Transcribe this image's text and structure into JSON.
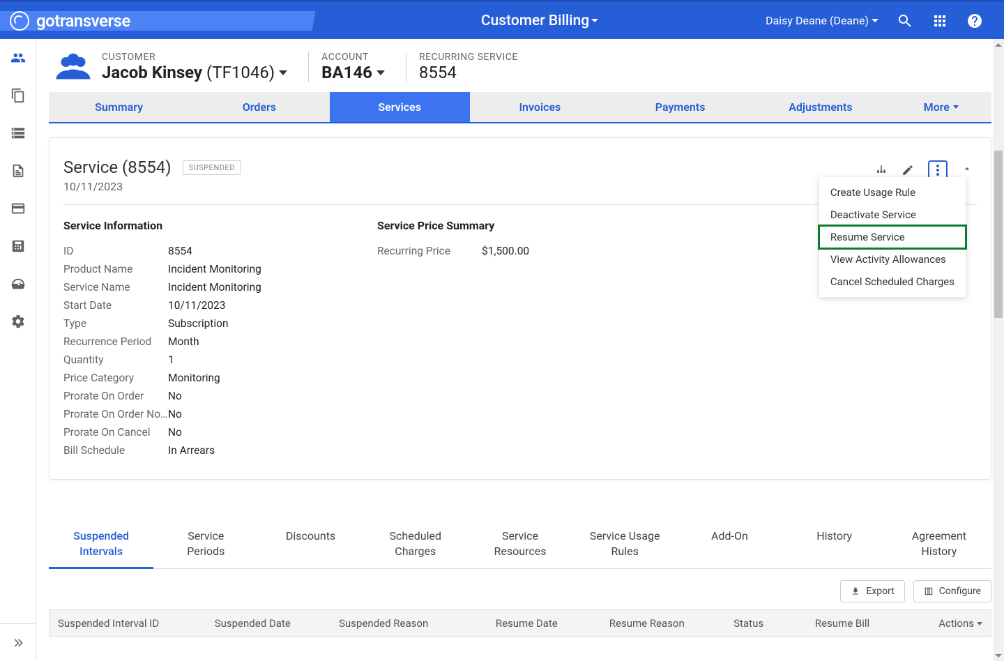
{
  "brand": "gotransverse",
  "header": {
    "title": "Customer Billing",
    "user": "Daisy Deane (Deane)"
  },
  "sidebar_icons": [
    "users",
    "copy",
    "storage",
    "document",
    "card",
    "calculator",
    "gauge",
    "gear"
  ],
  "page": {
    "customer_label": "CUSTOMER",
    "customer_name": "Jacob Kinsey",
    "customer_code": "(TF1046)",
    "account_label": "ACCOUNT",
    "account_number": "BA146",
    "service_label": "RECURRING SERVICE",
    "service_number": "8554"
  },
  "tabs": [
    "Summary",
    "Orders",
    "Services",
    "Invoices",
    "Payments",
    "Adjustments",
    "More"
  ],
  "active_tab": 2,
  "service_card": {
    "title": "Service (8554)",
    "status": "SUSPENDED",
    "date": "10/11/2023",
    "info_heading": "Service Information",
    "price_heading": "Service Price Summary",
    "fields": [
      {
        "label": "ID",
        "value": "8554"
      },
      {
        "label": "Product Name",
        "value": "Incident Monitoring"
      },
      {
        "label": "Service Name",
        "value": "Incident Monitoring"
      },
      {
        "label": "Start Date",
        "value": "10/11/2023"
      },
      {
        "label": "Type",
        "value": "Subscription"
      },
      {
        "label": "Recurrence Period",
        "value": "Month"
      },
      {
        "label": "Quantity",
        "value": "1"
      },
      {
        "label": "Price Category",
        "value": "Monitoring"
      },
      {
        "label": "Prorate On Order",
        "value": "No"
      },
      {
        "label": "Prorate On Order No…",
        "value": "No"
      },
      {
        "label": "Prorate On Cancel",
        "value": "No"
      },
      {
        "label": "Bill Schedule",
        "value": "In Arrears"
      }
    ],
    "price_rows": [
      {
        "label": "Recurring Price",
        "value": "$1,500.00"
      }
    ]
  },
  "dropdown": {
    "items": [
      "Create Usage Rule",
      "Deactivate Service",
      "Resume Service",
      "View Activity Allowances",
      "Cancel Scheduled Charges"
    ],
    "highlight_index": 2
  },
  "subtabs": [
    "Suspended Intervals",
    "Service Periods",
    "Discounts",
    "Scheduled Charges",
    "Service Resources",
    "Service Usage Rules",
    "Add-On",
    "History",
    "Agreement History"
  ],
  "active_subtab": 0,
  "toolbar": {
    "export": "Export",
    "configure": "Configure"
  },
  "table_columns": [
    "Suspended Interval ID",
    "Suspended Date",
    "Suspended Reason",
    "Resume Date",
    "Resume Reason",
    "Status",
    "Resume Bill",
    "Actions"
  ]
}
